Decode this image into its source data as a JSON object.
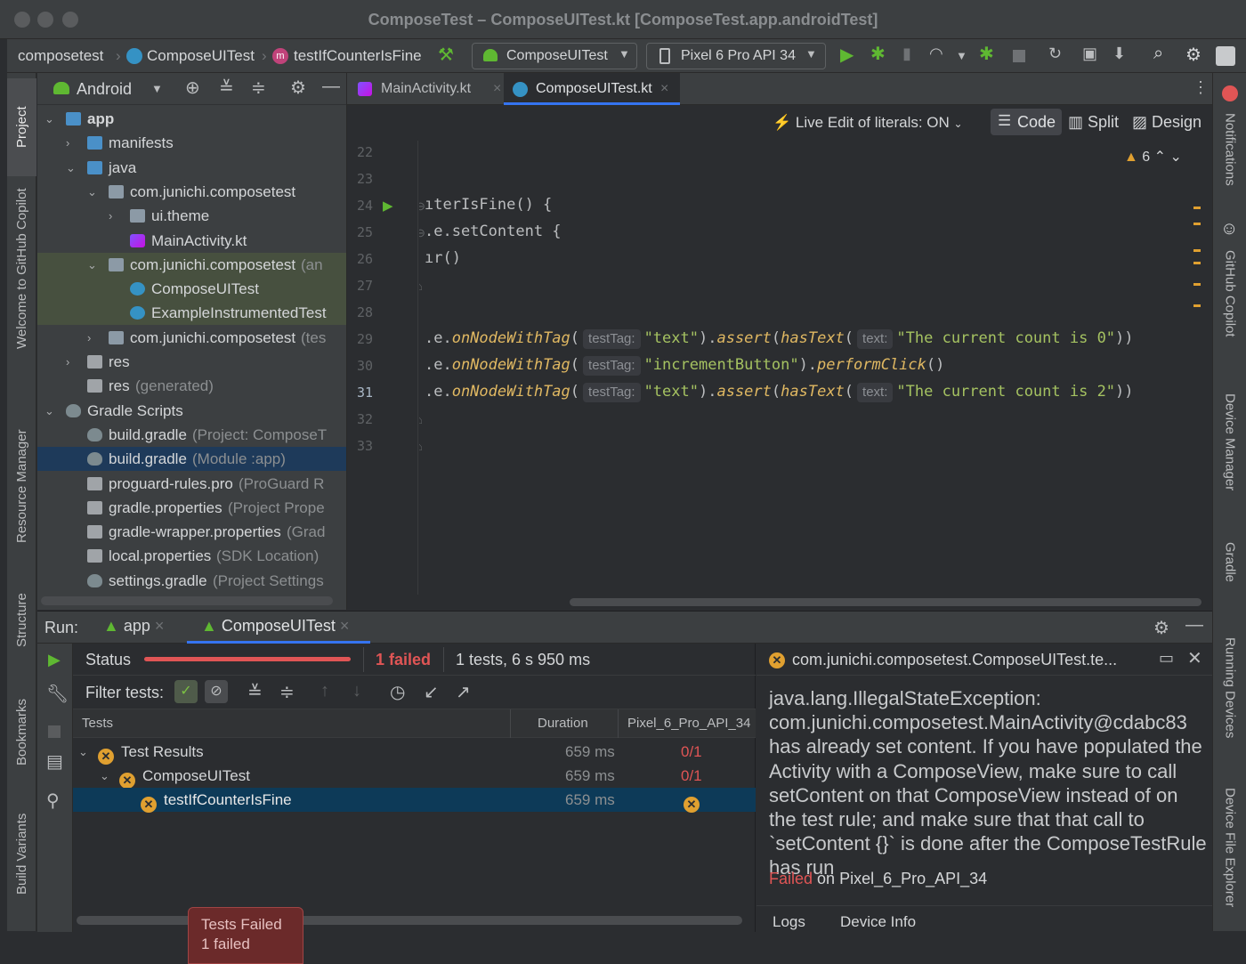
{
  "window": {
    "title": "ComposeTest – ComposeUITest.kt [ComposeTest.app.androidTest]"
  },
  "breadcrumb": {
    "project": "composetest",
    "file": "ComposeUITest",
    "method": "testIfCounterIsFine"
  },
  "toolbar": {
    "run_config": "ComposeUITest",
    "device": "Pixel 6 Pro API 34"
  },
  "left_tool_tabs": [
    "Project",
    "Welcome to GitHub Copilot",
    "Resource Manager",
    "Structure",
    "Bookmarks",
    "Build Variants"
  ],
  "right_tool_tabs": [
    "Notifications",
    "GitHub Copilot",
    "Device Manager",
    "Gradle",
    "Running Devices",
    "Device File Explorer"
  ],
  "project_panel": {
    "view": "Android",
    "tree": [
      {
        "label": "app",
        "hint": "",
        "arrow": "⌄",
        "icon": "app-module-icon"
      },
      {
        "label": "manifests",
        "hint": "",
        "arrow": "›",
        "icon": "folder-icon"
      },
      {
        "label": "java",
        "hint": "",
        "arrow": "⌄",
        "icon": "folder-icon"
      },
      {
        "label": "com.junichi.composetest",
        "hint": "",
        "arrow": "⌄",
        "icon": "package-icon"
      },
      {
        "label": "ui.theme",
        "hint": "",
        "arrow": "›",
        "icon": "package-icon"
      },
      {
        "label": "MainActivity.kt",
        "hint": "",
        "arrow": "",
        "icon": "kotlin-file-icon"
      },
      {
        "label": "com.junichi.composetest",
        "hint": "(an",
        "arrow": "⌄",
        "icon": "package-icon"
      },
      {
        "label": "ComposeUITest",
        "hint": "",
        "arrow": "",
        "icon": "test-class-icon"
      },
      {
        "label": "ExampleInstrumentedTest",
        "hint": "",
        "arrow": "",
        "icon": "test-class-icon"
      },
      {
        "label": "com.junichi.composetest",
        "hint": "(tes",
        "arrow": "›",
        "icon": "package-icon"
      },
      {
        "label": "res",
        "hint": "",
        "arrow": "›",
        "icon": "res-folder-icon"
      },
      {
        "label": "res",
        "hint": "(generated)",
        "arrow": "",
        "icon": "res-folder-icon"
      },
      {
        "label": "Gradle Scripts",
        "hint": "",
        "arrow": "⌄",
        "icon": "gradle-icon"
      },
      {
        "label": "build.gradle",
        "hint": "(Project: ComposeT",
        "arrow": "",
        "icon": "gradle-icon"
      },
      {
        "label": "build.gradle",
        "hint": "(Module :app)",
        "arrow": "",
        "icon": "gradle-icon"
      },
      {
        "label": "proguard-rules.pro",
        "hint": "(ProGuard R",
        "arrow": "",
        "icon": "text-file-icon"
      },
      {
        "label": "gradle.properties",
        "hint": "(Project Prope",
        "arrow": "",
        "icon": "properties-icon"
      },
      {
        "label": "gradle-wrapper.properties",
        "hint": "(Grad",
        "arrow": "",
        "icon": "properties-icon"
      },
      {
        "label": "local.properties",
        "hint": "(SDK Location)",
        "arrow": "",
        "icon": "properties-icon"
      },
      {
        "label": "settings.gradle",
        "hint": "(Project Settings",
        "arrow": "",
        "icon": "gradle-icon"
      }
    ]
  },
  "editor": {
    "tabs": [
      "MainActivity.kt",
      "ComposeUITest.kt"
    ],
    "live_edit": "Live Edit of literals: ON",
    "view_modes": [
      "Code",
      "Split",
      "Design"
    ],
    "warnings_count": "6",
    "line_numbers": [
      "22",
      "23",
      "24",
      "25",
      "26",
      "27",
      "28",
      "29",
      "30",
      "31",
      "32",
      "33"
    ],
    "code": {
      "l24": "ıterIsFine() {",
      "l25": ".e.setContent {",
      "l26": "ır()",
      "l29": {
        "pre": ".e.",
        "f1": "onNodeWithTag",
        "h1": "testTag:",
        "s1": "\"text\"",
        "m1": ").",
        "f2": "assert",
        "p2": "(",
        "f3": "hasText",
        "h2": "text:",
        "s2": "\"The current count is 0\"",
        "end": "))"
      },
      "l30": {
        "pre": ".e.",
        "f1": "onNodeWithTag",
        "h1": "testTag:",
        "s1": "\"incrementButton\"",
        "m1": ").",
        "f2": "performClick",
        "end": "()"
      },
      "l31": {
        "pre": ".e.",
        "f1": "onNodeWithTag",
        "h1": "testTag:",
        "s1": "\"text\"",
        "m1": ").",
        "f2": "assert",
        "p2": "(",
        "f3": "hasText",
        "h2": "text:",
        "s2": "\"The current count is 2\"",
        "end": "))"
      }
    }
  },
  "run_panel": {
    "label": "Run:",
    "tabs": [
      "app",
      "ComposeUITest"
    ],
    "status_label": "Status",
    "failed_text": "1 failed",
    "summary": "1 tests, 6 s 950 ms",
    "filter_label": "Filter tests:",
    "columns": [
      "Tests",
      "Duration",
      "Pixel_6_Pro_API_34"
    ],
    "rows": [
      {
        "name": "Test Results",
        "duration": "659 ms",
        "result": "0/1"
      },
      {
        "name": "ComposeUITest",
        "duration": "659 ms",
        "result": "0/1"
      },
      {
        "name": "testIfCounterIsFine",
        "duration": "659 ms",
        "result": ""
      }
    ],
    "detail_title": "com.junichi.composetest.ComposeUITest.te...",
    "error_message": "java.lang.IllegalStateException: com.junichi.composetest.MainActivity@cdabc83 has already set content. If you have populated the Activity with a ComposeView, make sure to call setContent on that ComposeView instead of on the test rule; and make sure that that call to `setContent {}` is done after the ComposeTestRule has run",
    "failed_word": "Failed",
    "failed_on": "on Pixel_6_Pro_API_34",
    "bottom_tabs": [
      "Logs",
      "Device Info"
    ]
  },
  "toast": {
    "title": "Tests Failed",
    "body": "1 failed"
  },
  "colors": {
    "accent": "#3574f0",
    "fail": "#e05555",
    "warning": "#e0a030",
    "run_green": "#5fb832"
  }
}
